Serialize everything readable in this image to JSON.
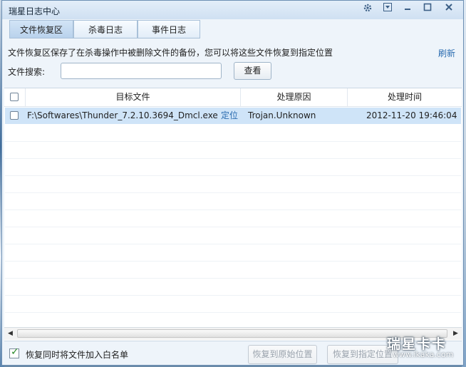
{
  "window": {
    "title": "瑞星日志中心",
    "controls": [
      "settings-icon",
      "menu-icon",
      "minimize-icon",
      "maximize-icon",
      "close-icon"
    ]
  },
  "tabs": [
    {
      "label": "文件恢复区",
      "active": true
    },
    {
      "label": "杀毒日志",
      "active": false
    },
    {
      "label": "事件日志",
      "active": false
    }
  ],
  "description": "文件恢复区保存了在杀毒操作中被删除文件的备份，您可以将这些文件恢复到指定位置",
  "refresh_label": "刷新",
  "search": {
    "label": "文件搜索:",
    "value": "",
    "button": "查看"
  },
  "table": {
    "headers": [
      "目标文件",
      "处理原因",
      "处理时间"
    ],
    "rows": [
      {
        "file": "F:\\Softwares\\Thunder_7.2.10.3694_Dmcl.exe",
        "locate": "定位",
        "reason": "Trojan.Unknown",
        "time": "2012-11-20 19:46:04",
        "checked": false,
        "selected": true
      }
    ]
  },
  "footer": {
    "whitelist_label": "恢复同时将文件加入白名单",
    "whitelist_checked": true,
    "restore_original": "恢复到原始位置",
    "restore_specified": "恢复到指定位置"
  },
  "watermark": {
    "main": "瑞星卡卡",
    "sub": "www.ikaka.com"
  },
  "colors": {
    "link": "#2b6cb0",
    "selected_row": "#cfe4f8",
    "titlebar": "#cfe0f2"
  }
}
